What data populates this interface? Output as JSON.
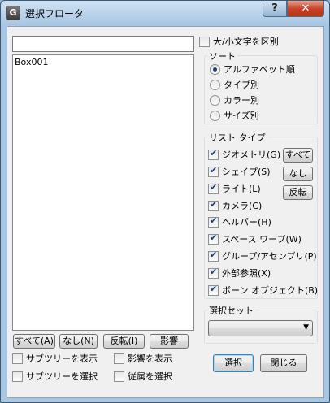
{
  "window": {
    "title": "選択フロータ",
    "app_icon": "G",
    "help_label": "?",
    "close_label": "✕"
  },
  "search": {
    "value": "",
    "placeholder": ""
  },
  "case_sensitive": {
    "label": "大/小文字を区別",
    "checked": false
  },
  "object_list": {
    "items": [
      "Box001"
    ]
  },
  "sort": {
    "label": "ソート",
    "options": [
      "アルファベット順",
      "タイプ別",
      "カラー別",
      "サイズ別"
    ],
    "selected": 0
  },
  "list_type": {
    "label": "リスト タイプ",
    "items": [
      {
        "label": "ジオメトリ(G)",
        "checked": true
      },
      {
        "label": "シェイプ(S)",
        "checked": true
      },
      {
        "label": "ライト(L)",
        "checked": true
      },
      {
        "label": "カメラ(C)",
        "checked": true
      },
      {
        "label": "ヘルパー(H)",
        "checked": true
      },
      {
        "label": "スペース ワープ(W)",
        "checked": true
      },
      {
        "label": "グループ/アセンブリ(P)",
        "checked": true
      },
      {
        "label": "外部参照(X)",
        "checked": true
      },
      {
        "label": "ボーン オブジェクト(B)",
        "checked": true
      }
    ],
    "all_label": "すべて",
    "none_label": "なし",
    "invert_label": "反転"
  },
  "selection_set": {
    "label": "選択セット",
    "value": ""
  },
  "list_buttons": {
    "all": "すべて(A)",
    "none": "なし(N)",
    "invert": "反転(I)",
    "influence": "影響"
  },
  "options": {
    "show_subtree": {
      "label": "サブツリーを表示",
      "checked": false
    },
    "show_influence": {
      "label": "影響を表示",
      "checked": false
    },
    "select_subtree": {
      "label": "サブツリーを選択",
      "checked": false
    },
    "select_dependents": {
      "label": "従属を選択",
      "checked": false
    }
  },
  "actions": {
    "select": "選択",
    "close": "閉じる"
  }
}
